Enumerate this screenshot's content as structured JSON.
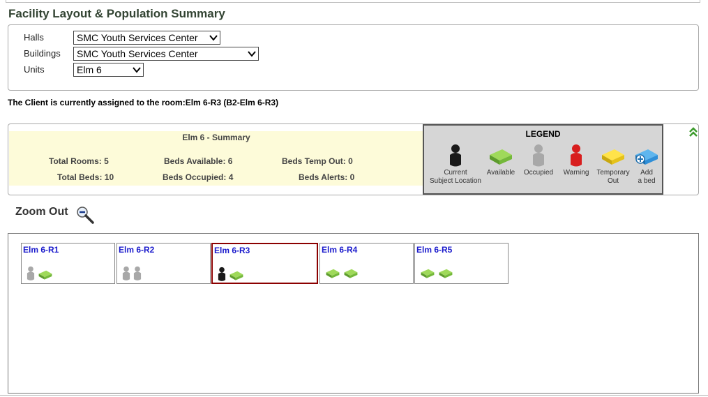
{
  "page": {
    "title": "Facility Layout & Population Summary"
  },
  "filters": {
    "halls": {
      "label": "Halls",
      "value": "SMC Youth Services Center"
    },
    "buildings": {
      "label": "Buildings",
      "value": "SMC Youth Services Center"
    },
    "units": {
      "label": "Units",
      "value": "Elm 6"
    }
  },
  "assignment": {
    "text": "The Client is currently assigned to the room:Elm 6-R3 (B2-Elm 6-R3)"
  },
  "summary": {
    "title": "Elm 6 - Summary",
    "total_rooms": "Total Rooms:  5",
    "total_beds": "Total Beds: 10",
    "beds_available": "Beds Available: 6",
    "beds_occupied": "Beds Occupied: 4",
    "beds_temp_out": "Beds Temp Out: 0",
    "beds_alerts": "Beds Alerts: 0"
  },
  "legend": {
    "title": "LEGEND",
    "items": [
      {
        "icon": "current-subject-person-icon",
        "line1": "Current",
        "line2": "Subject Location",
        "color": "#1a1a1a"
      },
      {
        "icon": "available-bed-icon",
        "line1": "Available",
        "line2": "",
        "color": "#7dc242"
      },
      {
        "icon": "occupied-person-icon",
        "line1": "Occupied",
        "line2": "",
        "color": "#a8a8a8"
      },
      {
        "icon": "warning-person-icon",
        "line1": "Warning",
        "line2": "",
        "color": "#d81e1e"
      },
      {
        "icon": "temporary-out-bed-icon",
        "line1": "Temporary",
        "line2": "Out",
        "color": "#f2d11c"
      },
      {
        "icon": "add-bed-icon",
        "line1": "Add",
        "line2": "a bed",
        "color": "#2f8fd8"
      }
    ]
  },
  "zoom": {
    "label": "Zoom Out"
  },
  "rooms": [
    {
      "name": "Elm 6-R1",
      "beds": [
        "occupied",
        "available"
      ],
      "current": false
    },
    {
      "name": "Elm 6-R2",
      "beds": [
        "occupied",
        "occupied"
      ],
      "current": false
    },
    {
      "name": "Elm 6-R3",
      "beds": [
        "current",
        "available"
      ],
      "current": true
    },
    {
      "name": "Elm 6-R4",
      "beds": [
        "available",
        "available"
      ],
      "current": false
    },
    {
      "name": "Elm 6-R5",
      "beds": [
        "available",
        "available"
      ],
      "current": false
    }
  ],
  "colors": {
    "title": "#334433",
    "room_link": "#1a1acc",
    "current_room_border": "#8b0000",
    "summary_bg": "#fdfbd9",
    "legend_bg": "#d6d6d6",
    "collapse_green": "#3a9a2a"
  }
}
